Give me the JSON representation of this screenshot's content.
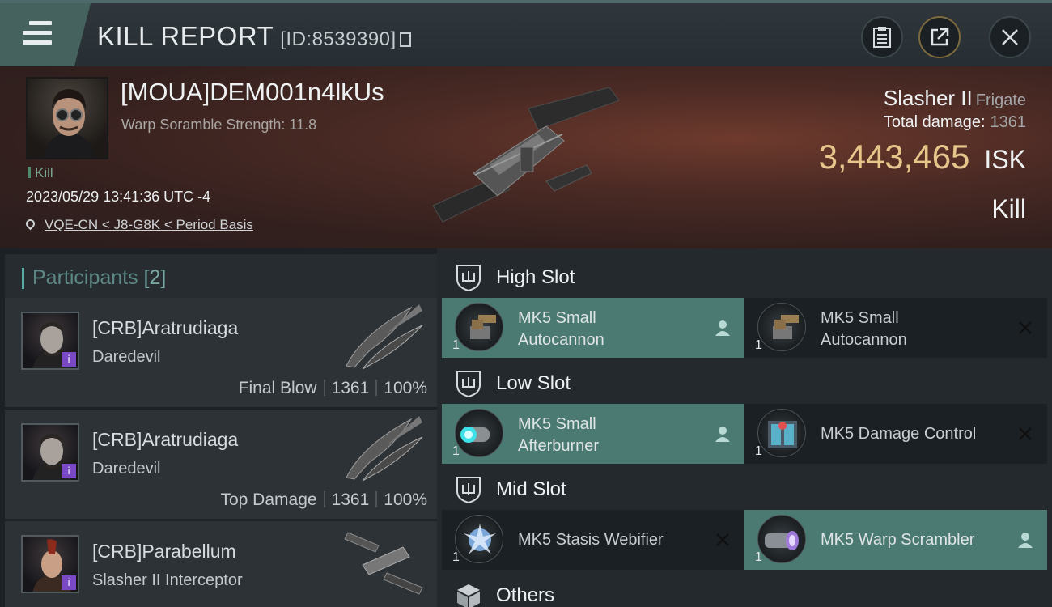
{
  "header": {
    "title": "KILL REPORT",
    "report_id": "[ID:8539390]"
  },
  "victim": {
    "name": "[MOUA]DEM001n4lkUs",
    "subtitle": "Warp Soramble Strength: 11.8",
    "tag": "Kill",
    "timestamp": "2023/05/29 13:41:36 UTC -4",
    "location": "VQE-CN < J8-G8K < Period Basis",
    "ship_name": "Slasher II",
    "ship_category": "Frigate",
    "total_damage_label": "Total damage:",
    "total_damage": "1361",
    "isk_value": "3,443,465",
    "isk_unit": "ISK",
    "result": "Kill"
  },
  "participants": {
    "title": "Participants",
    "count": "[2]",
    "list": [
      {
        "name": "[CRB]Aratrudiaga",
        "ship": "Daredevil",
        "role": "Final Blow",
        "damage": "1361",
        "percent": "100%"
      },
      {
        "name": "[CRB]Aratrudiaga",
        "ship": "Daredevil",
        "role": "Top Damage",
        "damage": "1361",
        "percent": "100%"
      },
      {
        "name": "[CRB]Parabellum",
        "ship": "Slasher II Interceptor"
      }
    ]
  },
  "slots": {
    "high": {
      "title": "High Slot",
      "modules": [
        {
          "line1": "MK5 Small",
          "line2": "Autocannon",
          "qty": "1",
          "status": "fitted"
        },
        {
          "line1": "MK5 Small",
          "line2": "Autocannon",
          "qty": "1",
          "status": "destroyed"
        }
      ]
    },
    "low": {
      "title": "Low Slot",
      "modules": [
        {
          "line1": "MK5 Small",
          "line2": "Afterburner",
          "qty": "1",
          "status": "fitted"
        },
        {
          "line1": "MK5 Damage Control",
          "qty": "1",
          "status": "destroyed"
        }
      ]
    },
    "mid": {
      "title": "Mid Slot",
      "modules": [
        {
          "line1": "MK5 Stasis Webifier",
          "qty": "1",
          "status": "destroyed"
        },
        {
          "line1": "MK5 Warp Scrambler",
          "qty": "1",
          "status": "fitted"
        }
      ]
    },
    "others": {
      "title": "Others"
    }
  },
  "colors": {
    "accent": "#4b7a72",
    "isk": "#e7c68b",
    "badge": "#7848c5"
  }
}
